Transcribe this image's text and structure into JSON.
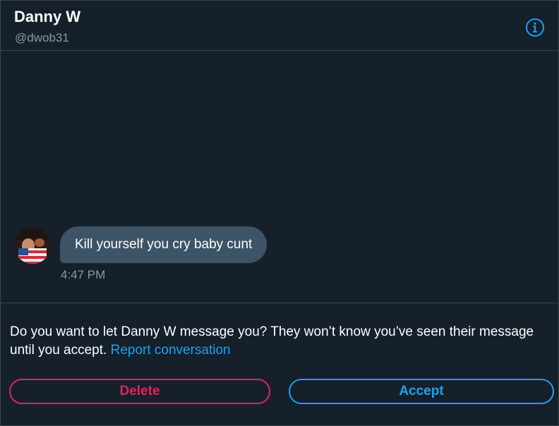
{
  "header": {
    "name": "Danny W",
    "handle": "@dwob31",
    "info_icon": "info-circle-icon"
  },
  "conversation": {
    "messages": [
      {
        "text": "Kill yourself you cry baby cunt",
        "time": "4:47 PM",
        "avatar": "user-avatar"
      }
    ]
  },
  "request": {
    "prompt": "Do you want to let Danny W message you? They won’t know you’ve seen their message until you accept.",
    "report_link": "Report conversation",
    "delete_label": "Delete",
    "accept_label": "Accept"
  },
  "colors": {
    "background": "#15202b",
    "divider": "#38444d",
    "bubble": "#3d5466",
    "secondary_text": "#8899a6",
    "accent": "#1da1f2",
    "danger": "#e0245e"
  }
}
